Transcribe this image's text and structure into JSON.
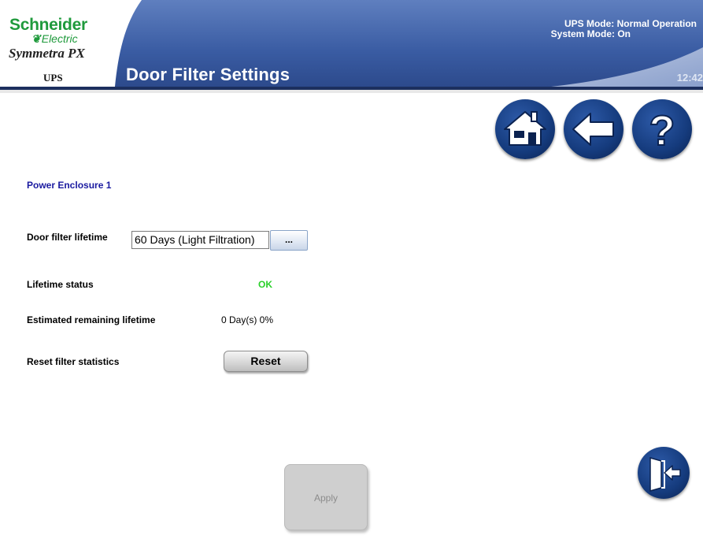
{
  "header": {
    "brand_name": "Schneider",
    "brand_sub": "Electric",
    "product": "Symmetra PX",
    "product_sub": "UPS",
    "title": "Door Filter Settings",
    "ups_mode": "UPS Mode: Normal Operation",
    "system_mode": "System Mode: On",
    "clock": "12:42"
  },
  "colors": {
    "brand_green": "#1f9a3c",
    "header_blue": "#2e4f96",
    "section_title": "#1a1aa0",
    "status_ok": "#2ad02a"
  },
  "nav": {
    "home_icon": "home-icon",
    "back_icon": "back-arrow-icon",
    "help_icon": "help-icon",
    "logout_icon": "logout-door-icon"
  },
  "main": {
    "section_title": "Power Enclosure 1",
    "filter_lifetime_label": "Door filter lifetime",
    "filter_lifetime_value": "60 Days (Light Filtration)",
    "filter_lifetime_button": "...",
    "lifetime_status_label": "Lifetime status",
    "lifetime_status_value": "OK",
    "remaining_label": "Estimated remaining lifetime",
    "remaining_value": "0 Day(s) 0%",
    "reset_label": "Reset filter statistics",
    "reset_button": "Reset",
    "apply_button": "Apply"
  }
}
